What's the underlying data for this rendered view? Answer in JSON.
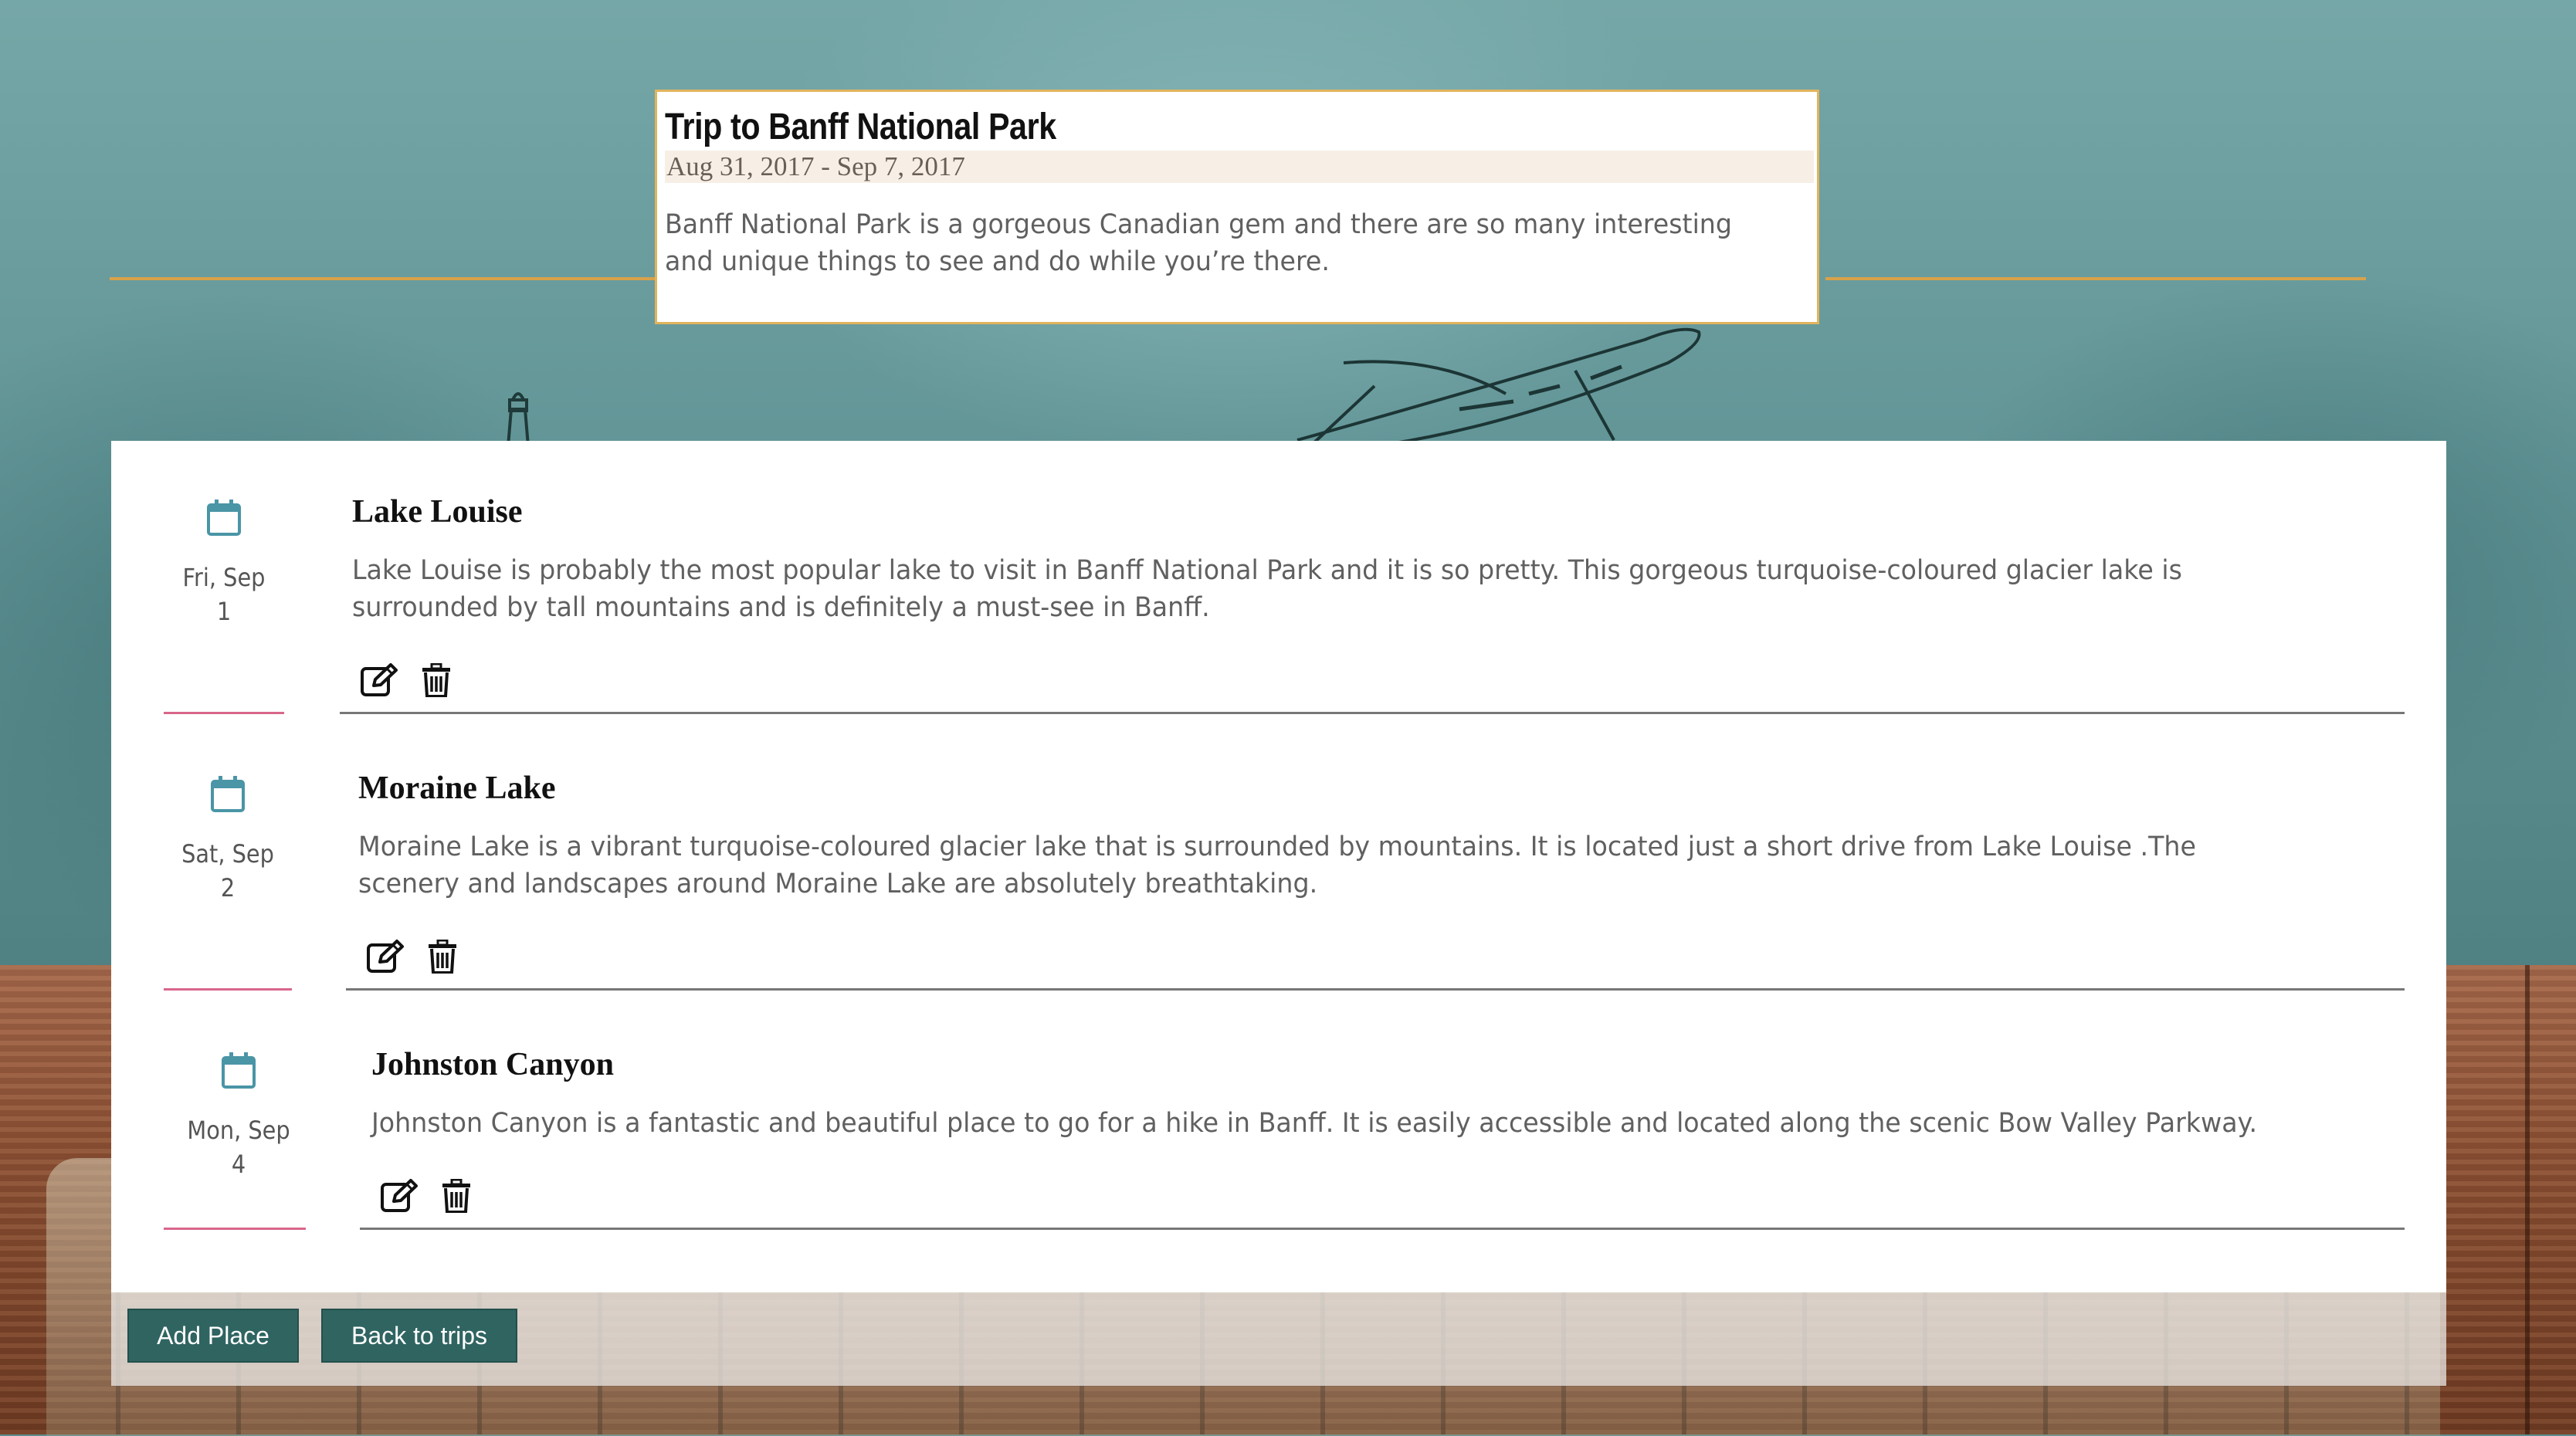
{
  "trip": {
    "title": "Trip to Banff National Park",
    "dates": "Aug 31, 2017 - Sep 7, 2017",
    "description": "Banff National Park is a gorgeous Canadian gem and there are so many interesting and unique things to see and do while you’re there."
  },
  "places": [
    {
      "day": "Fri, Sep",
      "date": "1",
      "name": "Lake Louise",
      "description": "Lake Louise is probably the most popular lake to visit in Banff National Park and it is so pretty. This gorgeous turquoise-coloured glacier lake is surrounded by tall mountains and is definitely a must-see in Banff."
    },
    {
      "day": "Sat, Sep",
      "date": "2",
      "name": "Moraine Lake",
      "description": "Moraine Lake is a vibrant turquoise-coloured glacier lake that is surrounded by mountains. It is located just a short drive from Lake Louise .The scenery and landscapes around Moraine Lake are absolutely breathtaking."
    },
    {
      "day": "Mon, Sep",
      "date": "4",
      "name": "Johnston Canyon",
      "description": "Johnston Canyon is a fantastic and beautiful place to go for a hike in Banff. It is easily accessible and located along the scenic Bow Valley Parkway."
    }
  ],
  "icons": {
    "calendar": "calendar-icon",
    "edit": "edit-icon",
    "delete": "trash-icon"
  },
  "buttons": {
    "add_place": "Add Place",
    "back_to_trips": "Back to trips"
  },
  "colors": {
    "accent_gold": "#e2b45c",
    "date_underline": "#d9668a",
    "calendar_icon": "#4a95a6",
    "button_bg": "#2f6461"
  }
}
